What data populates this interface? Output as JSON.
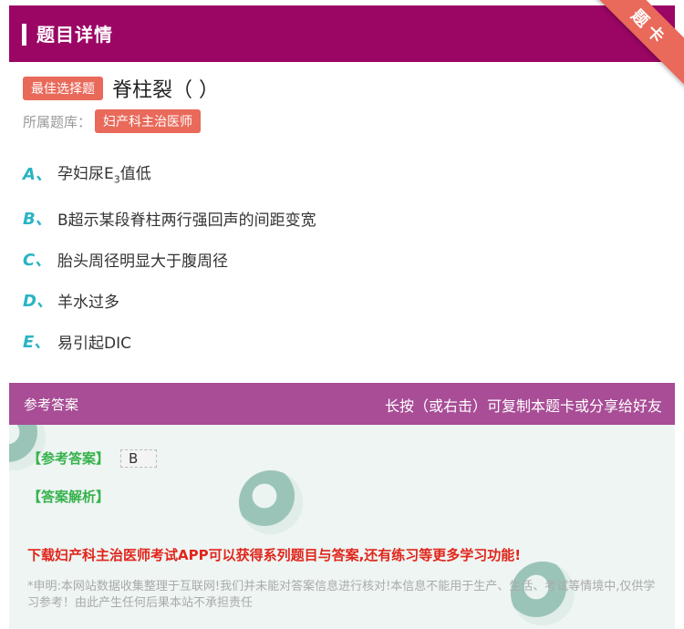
{
  "header": {
    "title": "题目详情",
    "ribbon": "题卡"
  },
  "question": {
    "type_tag": "最佳选择题",
    "text": "脊柱裂（ ）",
    "bank_label": "所属题库：",
    "bank_name": "妇产科主治医师"
  },
  "options": [
    {
      "letter": "A、",
      "text_before": "孕妇尿E",
      "sub": "3",
      "text_after": "值低"
    },
    {
      "letter": "B、",
      "text_before": "B超示某段脊柱两行强回声的间距变宽",
      "sub": "",
      "text_after": ""
    },
    {
      "letter": "C、",
      "text_before": "胎头周径明显大于腹周径",
      "sub": "",
      "text_after": ""
    },
    {
      "letter": "D、",
      "text_before": "羊水过多",
      "sub": "",
      "text_after": ""
    },
    {
      "letter": "E、",
      "text_before": "易引起DIC",
      "sub": "",
      "text_after": ""
    }
  ],
  "answer_section": {
    "title": "参考答案",
    "share_hint": "长按（或右击）可复制本题卡或分享给好友",
    "ref_label": "【参考答案】",
    "ref_value": "B",
    "analysis_label": "【答案解析】",
    "promo": "下载妇产科主治医师考试APP可以获得系列题目与答案,还有练习等更多学习功能!",
    "disclaimer": "*申明:本网站数据收集整理于互联网!我们并未能对答案信息进行核对!本信息不能用于生产、生活、考试等情境中,仅供学习参考！由此产生任何后果本站不承担责任"
  },
  "colors": {
    "header_bg": "#9b0664",
    "tag_bg": "#e9695a",
    "option_letter": "#29b4c4",
    "answer_header_bg": "#a84d96",
    "answer_body_bg": "#eef5f3",
    "green_label": "#36b24c",
    "promo_red": "#e1251b"
  }
}
